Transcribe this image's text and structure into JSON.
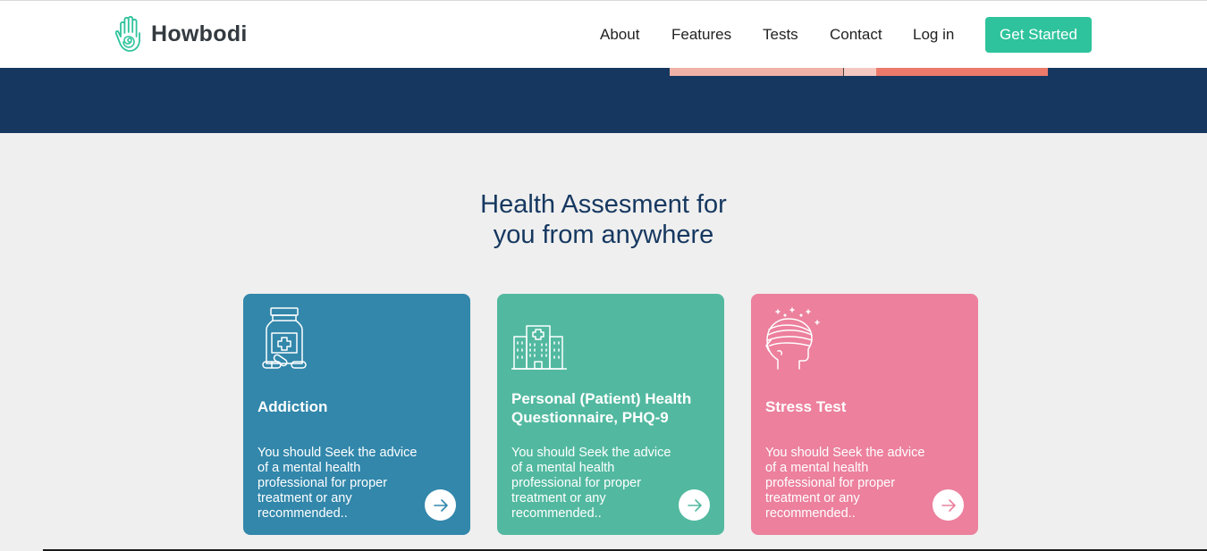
{
  "brand": {
    "name": "Howbodi",
    "logo_icon": "hand-spiral-icon"
  },
  "nav": {
    "items": [
      "About",
      "Features",
      "Tests",
      "Contact",
      "Log in"
    ],
    "cta": "Get Started"
  },
  "colors": {
    "navy": "#163860",
    "teal": "#2ec39c",
    "card_blue": "#3287ab",
    "card_green": "#52b9a0",
    "card_pink": "#ec809d"
  },
  "section": {
    "title_line1": "Health Assesment for",
    "title_line2": "you from anywhere"
  },
  "cards": [
    {
      "title": "Addiction",
      "description": "You should Seek the advice of a mental health professional for proper treatment or any recommended..",
      "icon": "medicine-bottle-icon"
    },
    {
      "title": "Personal (Patient) Health Questionnaire, PHQ-9",
      "description": "You should Seek the advice of a mental health professional for proper treatment or any recommended..",
      "icon": "hospital-building-icon"
    },
    {
      "title": "Stress Test",
      "description": "You should Seek the advice of a mental health professional for proper treatment or any recommended..",
      "icon": "head-bandage-icon"
    }
  ]
}
